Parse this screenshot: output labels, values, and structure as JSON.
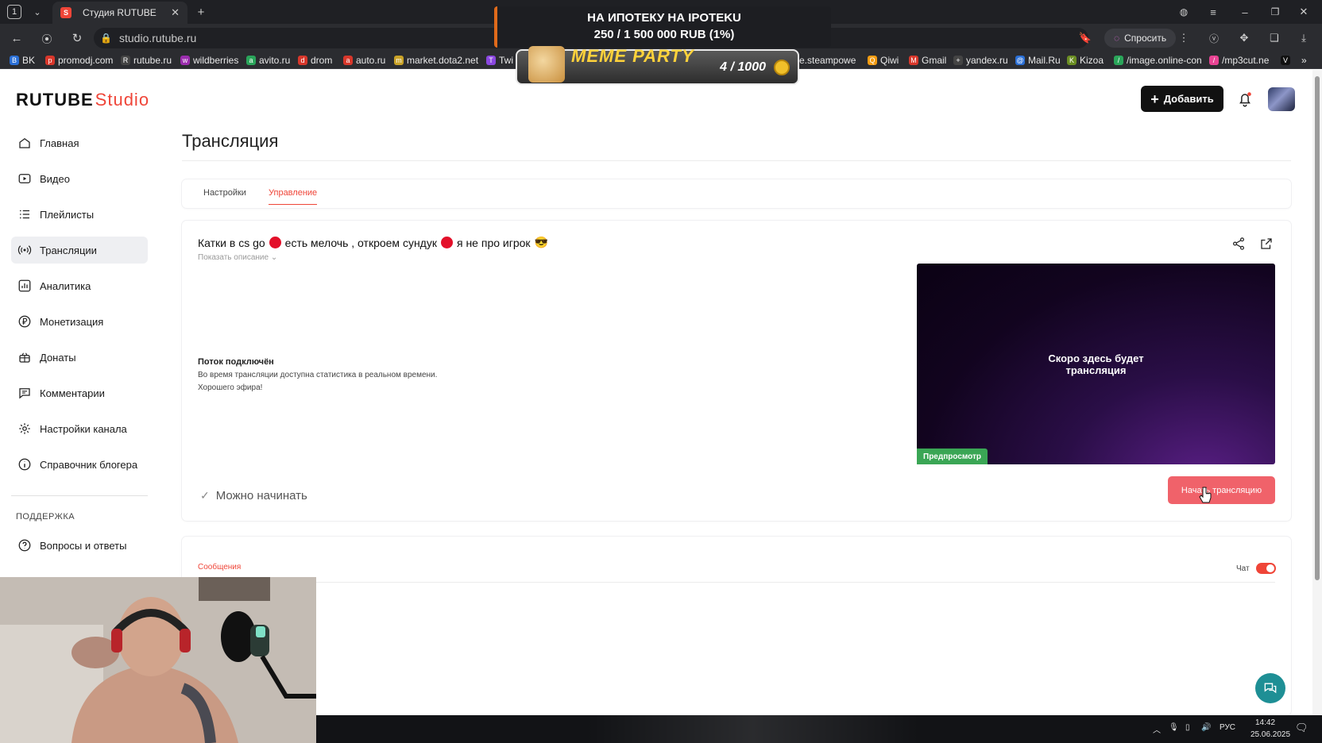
{
  "browser": {
    "tab_counter": "1",
    "active_tab_title": "Студия RUTUBE",
    "url": "studio.rutube.ru",
    "ask_button": "Спросить",
    "bookmarks": [
      "BK",
      "promodj.com",
      "rutube.ru",
      "wildberries",
      "avito.ru",
      "drom",
      "auto.ru",
      "market.dota2.net",
      "Twi",
      "e.steampowe",
      "Qiwi",
      "Gmail",
      "yandex.ru",
      "Mail.Ru",
      "Kizoa",
      "/image.online-con",
      "/mp3cut.ne"
    ]
  },
  "overlay": {
    "promo_line1": "НА ИПОТЕКУ НА IPOTEKU",
    "promo_line2": "250 / 1 500 000 RUB (1%)",
    "meme_title": "MEME PARTY",
    "meme_count": "4 / 1000"
  },
  "header": {
    "logo_main": "RUTUBE",
    "logo_accent": "Studio",
    "add_button": "Добавить"
  },
  "sidebar": {
    "items": [
      {
        "label": "Главная",
        "icon": "home-icon"
      },
      {
        "label": "Видео",
        "icon": "video-icon"
      },
      {
        "label": "Плейлисты",
        "icon": "playlist-icon"
      },
      {
        "label": "Трансляции",
        "icon": "broadcast-icon"
      },
      {
        "label": "Аналитика",
        "icon": "analytics-icon"
      },
      {
        "label": "Монетизация",
        "icon": "ruble-icon"
      },
      {
        "label": "Донаты",
        "icon": "gift-icon"
      },
      {
        "label": "Комментарии",
        "icon": "comment-icon"
      },
      {
        "label": "Настройки канала",
        "icon": "gear-icon"
      },
      {
        "label": "Справочник блогера",
        "icon": "info-icon"
      }
    ],
    "support_label": "ПОДДЕРЖКА",
    "support_items": [
      {
        "label": "Вопросы и ответы",
        "icon": "question-icon"
      }
    ]
  },
  "main": {
    "page_title": "Трансляция",
    "tabs": [
      {
        "label": "Настройки",
        "active": false
      },
      {
        "label": "Управление",
        "active": true
      }
    ],
    "stream_title_parts": [
      "Катки в cs go",
      "есть мелочь , откроем сундук",
      "я не про игрок",
      "😎"
    ],
    "show_description": "Показать описание",
    "connection_title": "Поток подключён",
    "connection_line1": "Во время трансляции доступна статистика в реальном времени.",
    "connection_line2": "Хорошего эфира!",
    "ready_text": "Можно начинать",
    "preview_text_line1": "Скоро здесь будет",
    "preview_text_line2": "трансляция",
    "preview_badge": "Предпросмотр",
    "start_button": "Начать трансляцию"
  },
  "chat": {
    "messages_label": "Сообщения",
    "chat_label": "Чат",
    "chat_enabled": true
  },
  "taskbar": {
    "lang": "РУС",
    "time": "14:42",
    "date": "25.06.2025"
  },
  "colors": {
    "accent": "#ef4538",
    "start_button": "#f0626a",
    "preview_badge": "#3aa655",
    "help_button": "#1e8f95"
  }
}
